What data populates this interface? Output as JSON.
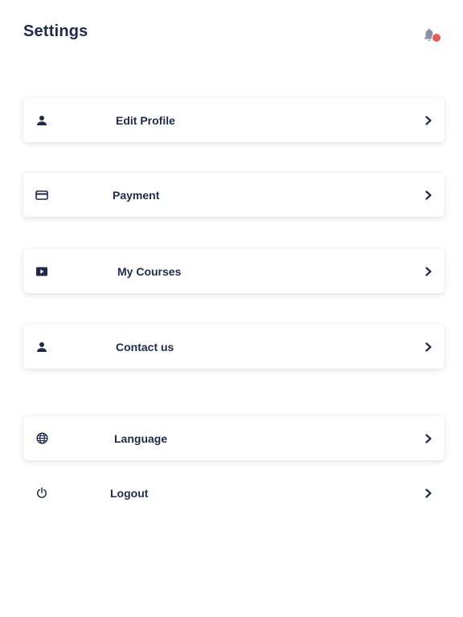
{
  "header": {
    "title": "Settings",
    "bell_icon": "bell-icon",
    "badge_color": "#e45b5b"
  },
  "menu": {
    "items": [
      {
        "label": "Edit Profile",
        "icon": "person-icon"
      },
      {
        "label": "Payment",
        "icon": "credit-card-icon"
      },
      {
        "label": "My Courses",
        "icon": "play-video-icon"
      },
      {
        "label": "Contact us",
        "icon": "person-icon"
      },
      {
        "label": "Language",
        "icon": "globe-icon"
      },
      {
        "label": "Logout",
        "icon": "power-icon"
      }
    ]
  },
  "colors": {
    "text": "#1e2a4a",
    "card_background": "#ffffff",
    "page_background": "#ffffff"
  }
}
